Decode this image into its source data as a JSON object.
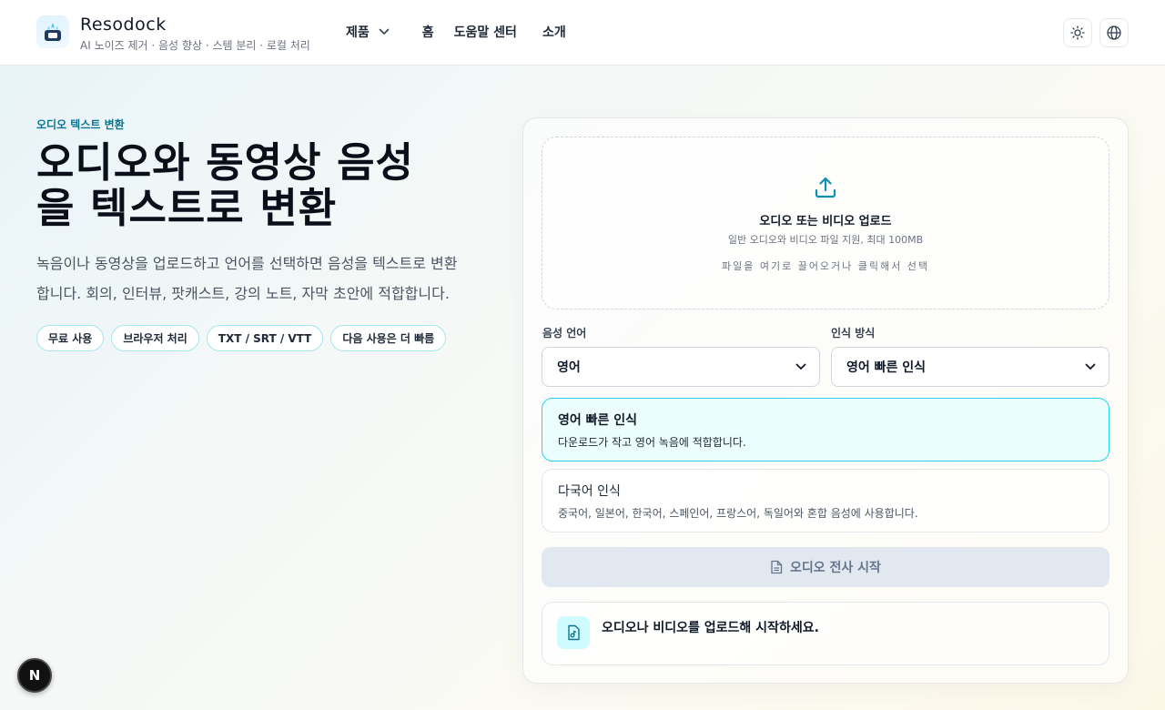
{
  "header": {
    "brand": "Resodock",
    "tagline": "AI 노이즈 제거 · 음성 향상 · 스템 분리 · 로컬 처리",
    "nav": {
      "products": "제품",
      "home": "홈",
      "help": "도움말 센터",
      "about": "소개"
    },
    "icons": [
      "sun-icon",
      "globe-icon"
    ]
  },
  "hero": {
    "eyebrow": "오디오 텍스트 변환",
    "title_line1": "오디오와 동영상 음성",
    "title_line2": "을 텍스트로 변환",
    "desc_line1": "녹음이나 동영상을 업로드하고 언어를 선택하면 음성을 텍스트로 변환",
    "desc_line2": "합니다. 회의, 인터뷰, 팟캐스트, 강의 노트, 자막 초안에 적합합니다.",
    "tags": [
      "무료 사용",
      "브라우저 처리",
      "TXT / SRT / VTT",
      "다음 사용은 더 빠름"
    ]
  },
  "upload": {
    "title": "오디오 또는 비디오 업로드",
    "subtitle": "일반 오디오와 비디오 파일 지원, 최대 100MB",
    "hint": "파일을 여기로 끌어오거나 클릭해서 선택"
  },
  "form": {
    "language_label": "음성 언어",
    "language_value": "영어",
    "mode_label": "인식 방식",
    "mode_value": "영어 빠른 인식"
  },
  "options": [
    {
      "title": "영어 빠른 인식",
      "desc": "다운로드가 작고 영어 녹음에 적합합니다.",
      "selected": true
    },
    {
      "title": "다국어 인식",
      "desc": "중국어, 일본어, 한국어, 스페인어, 프랑스어, 독일어와 혼합 음성에 사용합니다.",
      "selected": false
    }
  ],
  "start_button": "오디오 전사 시작",
  "status": "오디오나 비디오를 업로드해 시작하세요.",
  "dev_badge": "N",
  "colors": {
    "accent": "#0e7490",
    "accent_border": "#22d3ee",
    "tag_border": "#a5e7ee",
    "selected_bg": "#ecfdfe",
    "disabled_button": "#e2e8f0"
  }
}
